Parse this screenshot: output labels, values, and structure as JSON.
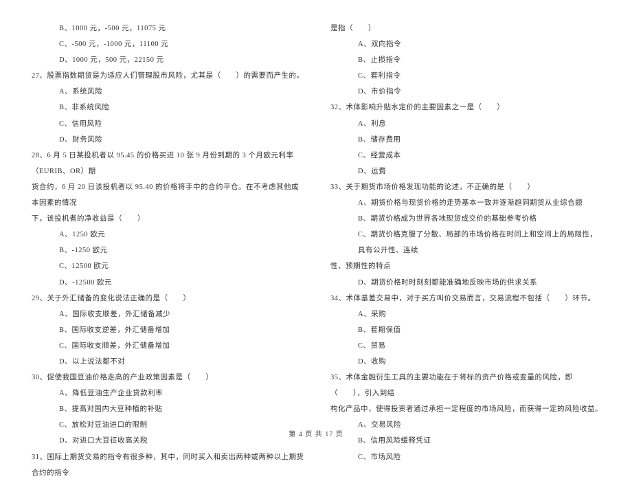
{
  "left": {
    "l0": "B、1000 元，-500 元，11075 元",
    "l1": "C、-500 元，-1000 元，11100 元",
    "l2": "D、1000 元，500 元，22150 元",
    "q27": "27、股票指数期货是为适应人们管理股市风险，尤其是（　　）的需要而产生的。",
    "q27a": "A、系统风险",
    "q27b": "B、非系统风险",
    "q27c": "C、信用风险",
    "q27d": "D、财务风险",
    "q28_1": "28、6 月 5 日某投机者以 95.45 的价格买进 10 张 9 月份到期的 3 个月欧元利率（EURIB、OR）期",
    "q28_2": "货合约，6 月 20 日该投机者以 95.40 的价格将手中的合约平仓。在不考虑其他成本因素的情况",
    "q28_3": "下，该投机者的净收益是（　　）",
    "q28a": "A、1250 欧元",
    "q28b": "B、-1250 欧元",
    "q28c": "C、12500 欧元",
    "q28d": "D、-12500 欧元",
    "q29": "29、关于外汇储备的变化说法正确的是（　　）",
    "q29a": "A、国际收支顺差，外汇储备减少",
    "q29b": "B、国际收支逆差，外汇储备增加",
    "q29c": "C、国际收支顺差，外汇储备增加",
    "q29d": "D、以上说法都不对",
    "q30": "30、促使我国豆油价格走高的产业政策因素是（　　）",
    "q30a": "A、降低豆油生产企业贷款利率",
    "q30b": "B、提高对国内大豆种植的补贴",
    "q30c": "C、放松对豆油进口的限制",
    "q30d": "D、对进口大豆征收高关税",
    "q31": "31、国际上期货交易的指令有很多种，其中，同时买入和卖出两种或两种以上期货合约的指令"
  },
  "right": {
    "r0": "是指（　　）",
    "r0a": "A、双向指令",
    "r0b": "B、止损指令",
    "r0c": "C、套利指令",
    "r0d": "D、市价指令",
    "q32": "32、术体影响升贴水定价的主要因素之一是（　　）",
    "q32a": "A、利息",
    "q32b": "B、储存费用",
    "q32c": "C、经营成本",
    "q32d": "D、运费",
    "q33": "33、关于期货市场价格发现功能的论述，不正确的是（　　）",
    "q33a": "A、期货价格与现货价格的走势基本一致并逐渐趋同期货从业综合题",
    "q33b": "B、期货价格成为世界各地现货成交价的基础参考价格",
    "q33c_1": "C、期货价格克服了分散、局部的市场价格在时间上和空间上的局限性，具有公开性、连续",
    "q33c_2": "性、预期性的特点",
    "q33d": "D、期货价格时时刻刻都能准确地反映市场的供求关系",
    "q34": "34、术体基差交易中，对于买方叫价交易而言，交易流程不包括（　　）环节。",
    "q34a": "A、采购",
    "q34b": "B、套期保值",
    "q34c": "C、贸易",
    "q34d": "D、收购",
    "q35_1": "35、术体金融衍生工具的主要功能在于将标的资产价格或变量的风险，即（　　），引入到结",
    "q35_2": "构化产品中，使得投资者通过承担一定程度的市场风险，而获得一定的风险收益。",
    "q35a": "A、交易风险",
    "q35b": "B、信用风险缓释凭证",
    "q35c": "C、市场风险"
  },
  "footer": "第 4 页 共 17 页"
}
